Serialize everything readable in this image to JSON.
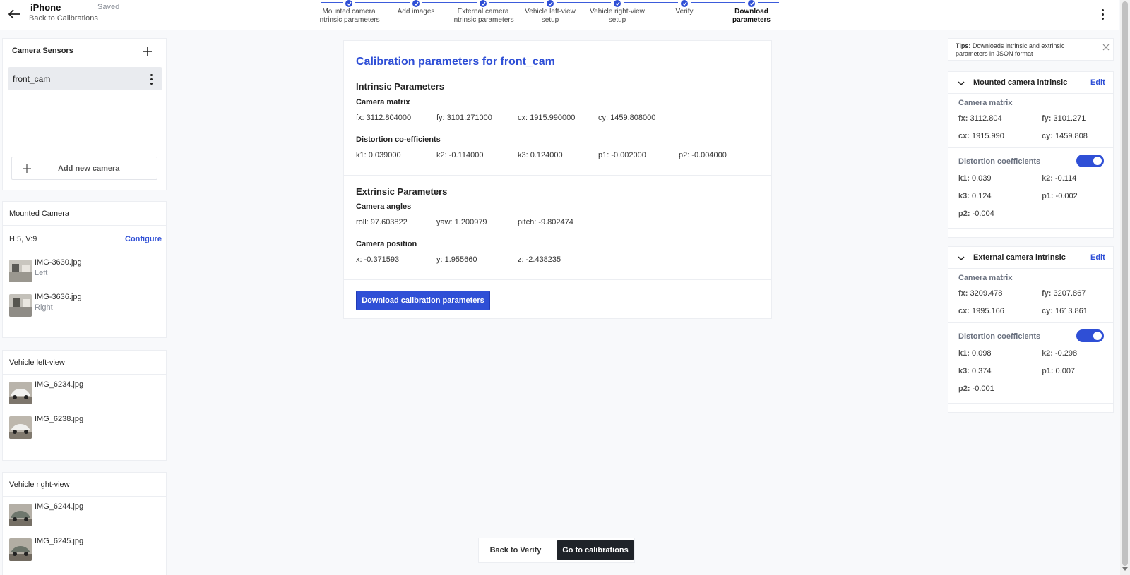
{
  "header": {
    "title": "iPhone",
    "saved": "Saved",
    "back_link": "Back to Calibrations"
  },
  "stepper": [
    {
      "label": "Mounted camera intrinsic parameters"
    },
    {
      "label": "Add images"
    },
    {
      "label": "External camera intrinsic parameters"
    },
    {
      "label": "Vehicle left-view setup"
    },
    {
      "label": "Vehicle right-view setup"
    },
    {
      "label": "Verify"
    },
    {
      "label": "Download parameters"
    }
  ],
  "sensors": {
    "title": "Camera Sensors",
    "camera": "front_cam",
    "add_label": "Add new camera"
  },
  "mounted": {
    "title": "Mounted Camera",
    "hv": "H:5, V:9",
    "configure": "Configure",
    "images": [
      {
        "name": "IMG-3630.jpg",
        "pos": "Left"
      },
      {
        "name": "IMG-3636.jpg",
        "pos": "Right"
      }
    ]
  },
  "left_view": {
    "title": "Vehicle left-view",
    "images": [
      {
        "name": "IMG_6234.jpg"
      },
      {
        "name": "IMG_6238.jpg"
      }
    ]
  },
  "right_view": {
    "title": "Vehicle right-view",
    "images": [
      {
        "name": "IMG_6244.jpg"
      },
      {
        "name": "IMG_6245.jpg"
      }
    ]
  },
  "main": {
    "title": "Calibration parameters for front_cam",
    "intrinsic_title": "Intrinsic Parameters",
    "camera_matrix_title": "Camera matrix",
    "camera_matrix": [
      "fx: 3112.804000",
      "fy: 3101.271000",
      "cx: 1915.990000",
      "cy: 1459.808000"
    ],
    "distortion_title": "Distortion co-efficients",
    "distortion": [
      "k1: 0.039000",
      "k2: -0.114000",
      "k3: 0.124000",
      "p1: -0.002000",
      "p2: -0.004000"
    ],
    "extrinsic_title": "Extrinsic Parameters",
    "angles_title": "Camera angles",
    "angles": [
      "roll: 97.603822",
      "yaw: 1.200979",
      "pitch: -9.802474"
    ],
    "position_title": "Camera position",
    "position": [
      "x: -0.371593",
      "y: 1.955660",
      "z: -2.438235"
    ],
    "download_button": "Download calibration parameters"
  },
  "tips": {
    "label": "Tips:",
    "text": " Downloads intrinsic and extrinsic parameters in JSON format"
  },
  "mounted_intrinsic": {
    "title": "Mounted camera intrinsic",
    "edit": "Edit",
    "matrix_title": "Camera matrix",
    "matrix": [
      {
        "k": "fx:",
        "v": " 3112.804"
      },
      {
        "k": "fy:",
        "v": " 3101.271"
      },
      {
        "k": "cx:",
        "v": " 1915.990"
      },
      {
        "k": "cy:",
        "v": " 1459.808"
      }
    ],
    "distortion_title": "Distortion coefficients",
    "distortion_enabled": true,
    "distortion": [
      {
        "k": "k1:",
        "v": " 0.039"
      },
      {
        "k": "k2:",
        "v": " -0.114"
      },
      {
        "k": "k3:",
        "v": " 0.124"
      },
      {
        "k": "p1:",
        "v": " -0.002"
      },
      {
        "k": "p2:",
        "v": " -0.004"
      }
    ]
  },
  "external_intrinsic": {
    "title": "External camera intrinsic",
    "edit": "Edit",
    "matrix_title": "Camera matrix",
    "matrix": [
      {
        "k": "fx:",
        "v": " 3209.478"
      },
      {
        "k": "fy:",
        "v": " 3207.867"
      },
      {
        "k": "cx:",
        "v": " 1995.166"
      },
      {
        "k": "cy:",
        "v": " 1613.861"
      }
    ],
    "distortion_title": "Distortion coefficients",
    "distortion_enabled": true,
    "distortion": [
      {
        "k": "k1:",
        "v": " 0.098"
      },
      {
        "k": "k2:",
        "v": " -0.298"
      },
      {
        "k": "k3:",
        "v": " 0.374"
      },
      {
        "k": "p1:",
        "v": " 0.007"
      },
      {
        "k": "p2:",
        "v": " -0.001"
      }
    ]
  },
  "actions": {
    "back": "Back to Verify",
    "go": "Go to calibrations"
  },
  "colors": {
    "accent": "#2f4fd6",
    "dark_button": "#1f2329"
  }
}
